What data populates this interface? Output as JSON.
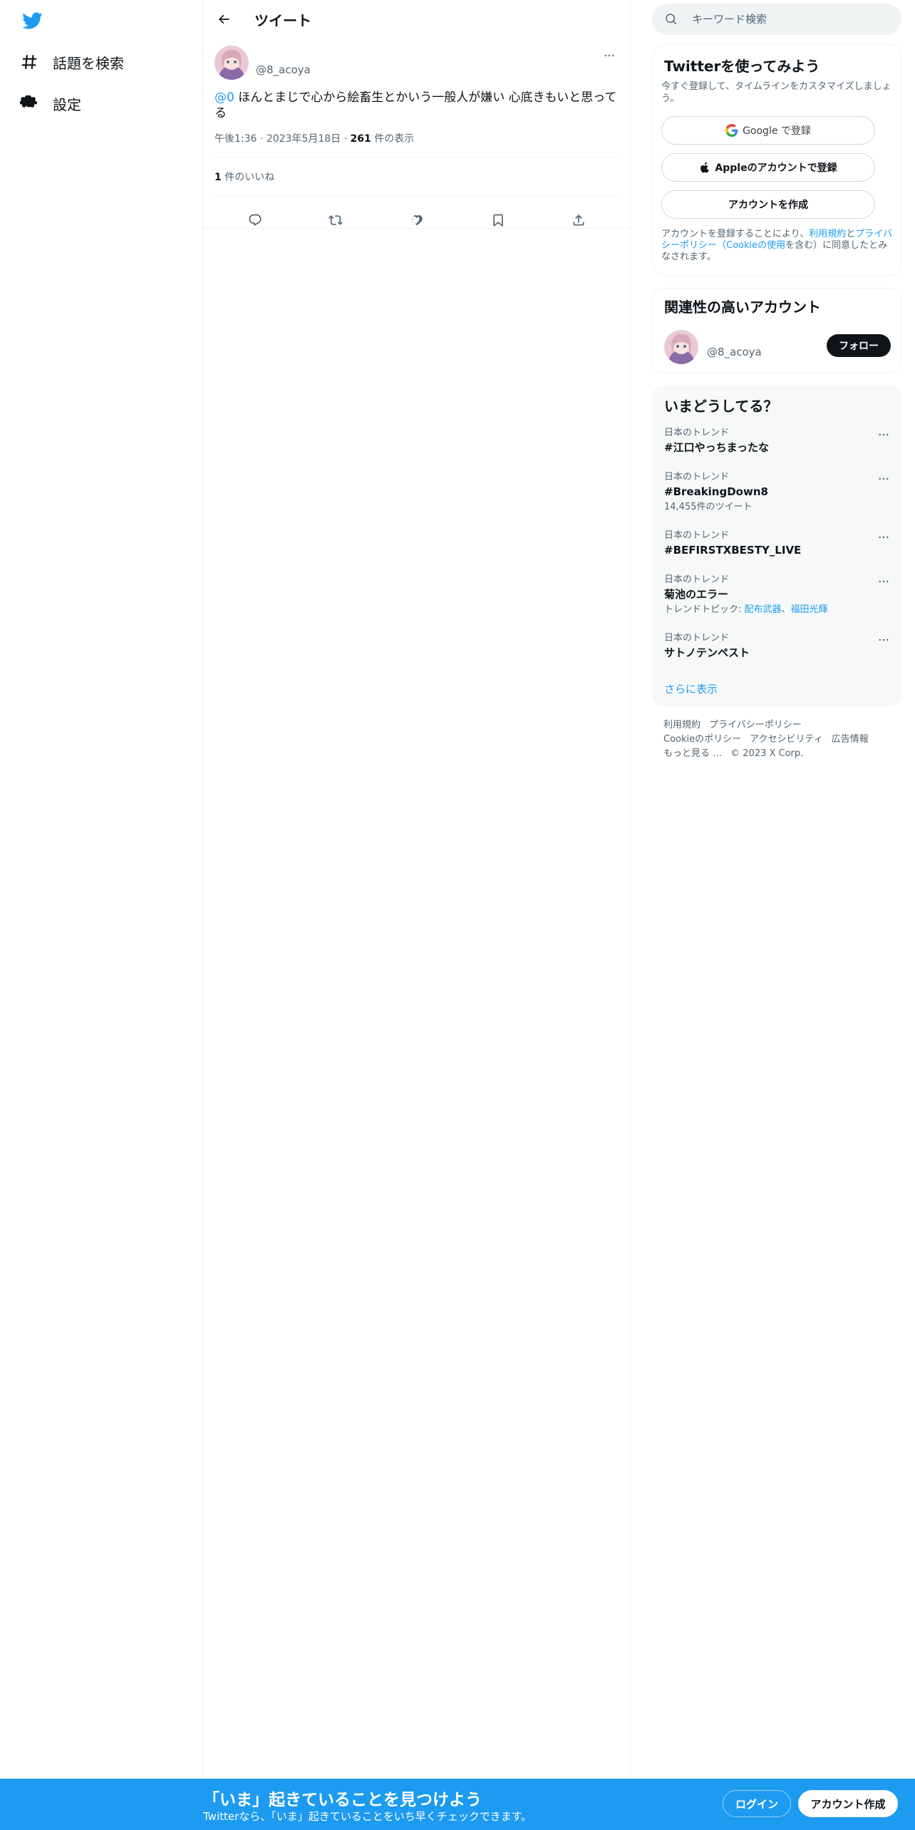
{
  "nav": {
    "items": [
      {
        "icon": "hashtag-icon",
        "label": "話題を検索"
      },
      {
        "icon": "gear-icon",
        "label": "設定"
      }
    ]
  },
  "header": {
    "title": "ツイート"
  },
  "tweet": {
    "handle": "@8_acoya",
    "mention": "@0",
    "text": " ほんとまじで心から絵畜生とかいう一般人が嫌い 心底きもいと思ってる",
    "time": "午後1:36",
    "date": "2023年5月18日",
    "views_count": "261",
    "views_label": " 件の表示",
    "likes_count": "1",
    "likes_label": " 件のいいね"
  },
  "search": {
    "placeholder": "キーワード検索"
  },
  "signup": {
    "title": "Twitterを使ってみよう",
    "subtitle": "今すぐ登録して、タイムラインをカスタマイズしましょう。",
    "google_label": "Google で登録",
    "apple_label": "Appleのアカウントで登録",
    "create_label": "アカウントを作成",
    "legal_prefix": "アカウントを登録することにより、",
    "terms_link": "利用規約",
    "and": "と",
    "privacy_link": "プライバシーポリシー（Cookieの使用",
    "legal_suffix": "を含む）に同意したとみなされます。"
  },
  "related": {
    "title": "関連性の高いアカウント",
    "handle": "@8_acoya",
    "follow_label": "フォロー"
  },
  "trends": {
    "title": "いまどうしてる？",
    "items": [
      {
        "context": "日本のトレンド",
        "name": "#江口やっちまったな"
      },
      {
        "context": "日本のトレンド",
        "name": "#BreakingDown8",
        "extra": "14,455件のツイート"
      },
      {
        "context": "日本のトレンド",
        "name": "#BEFIRSTXBESTY_LIVE"
      },
      {
        "context": "日本のトレンド",
        "name": "菊池のエラー",
        "topic_prefix": "トレンドトピック: ",
        "topic_1": "配布武器",
        "topic_sep": "、",
        "topic_2": "福田光輝"
      },
      {
        "context": "日本のトレンド",
        "name": "サトノテンペスト"
      }
    ],
    "show_more": "さらに表示"
  },
  "footer": {
    "links": [
      "利用規約",
      "プライバシーポリシー",
      "Cookieのポリシー",
      "アクセシビリティ",
      "広告情報",
      "もっと見る …",
      "© 2023 X Corp."
    ]
  },
  "bottombar": {
    "title": "「いま」起きていることを見つけよう",
    "subtitle": "Twitterなら、「いま」起きていることをいち早くチェックできます。",
    "login_label": "ログイン",
    "signup_label": "アカウント作成"
  },
  "colors": {
    "accent": "#1d9bf0",
    "text": "#0f1419",
    "secondary": "#536471",
    "border": "#eff3f4"
  }
}
